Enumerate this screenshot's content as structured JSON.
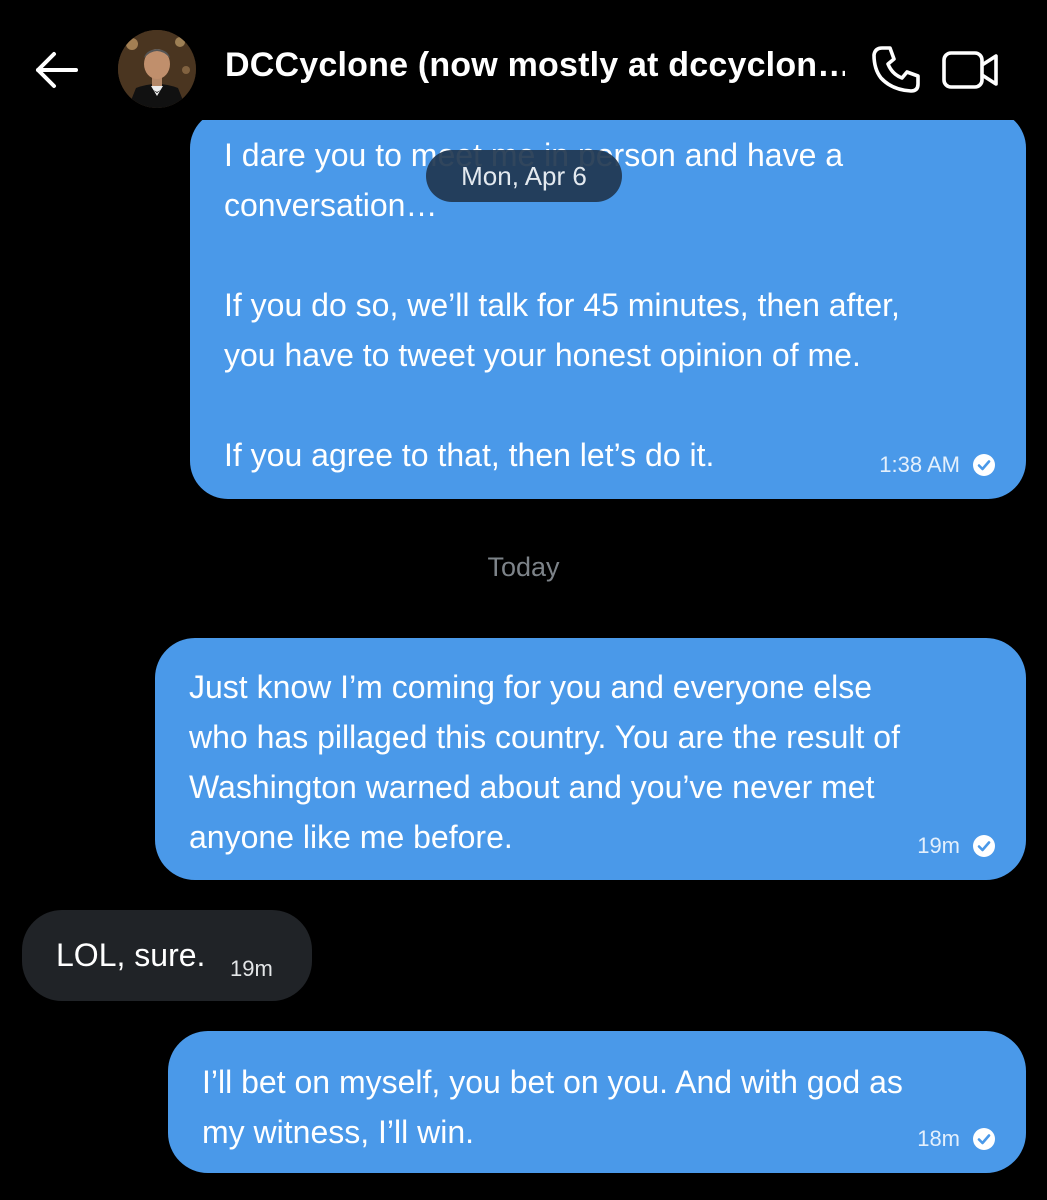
{
  "header": {
    "title": "DCCyclone (now mostly at dccyclon…",
    "back_icon": "arrow-left-icon",
    "call_icon": "phone-icon",
    "video_icon": "video-camera-icon",
    "avatar": "contact-avatar"
  },
  "colors": {
    "background": "#000000",
    "outgoing_bubble": "#4a99e9",
    "incoming_bubble": "#202327",
    "date_pill": "#1f364f",
    "muted_text": "#7d8389"
  },
  "date_pill": "Mon, Apr 6",
  "day_separator": "Today",
  "messages": [
    {
      "direction": "outgoing",
      "text": "I dare you to meet me in person and have a\nconversation…\n\nIf you do so, we’ll talk for 45 minutes, then after,\nyou have to tweet your honest opinion of me.\n\nIf you agree to that, then let’s do it.",
      "time": "1:38 AM",
      "status_icon": "read-check-icon"
    },
    {
      "direction": "outgoing",
      "text": "Just know I’m coming for you and everyone else\nwho has pillaged this country. You are the result of\nWashington warned about and you’ve never met\nanyone like me before.",
      "time": "19m",
      "status_icon": "read-check-icon"
    },
    {
      "direction": "incoming",
      "text": "LOL, sure.",
      "time": "19m"
    },
    {
      "direction": "outgoing",
      "text": "I’ll bet on myself, you bet on you. And with god as\nmy witness, I’ll win.",
      "time": "18m",
      "status_icon": "read-check-icon"
    }
  ]
}
